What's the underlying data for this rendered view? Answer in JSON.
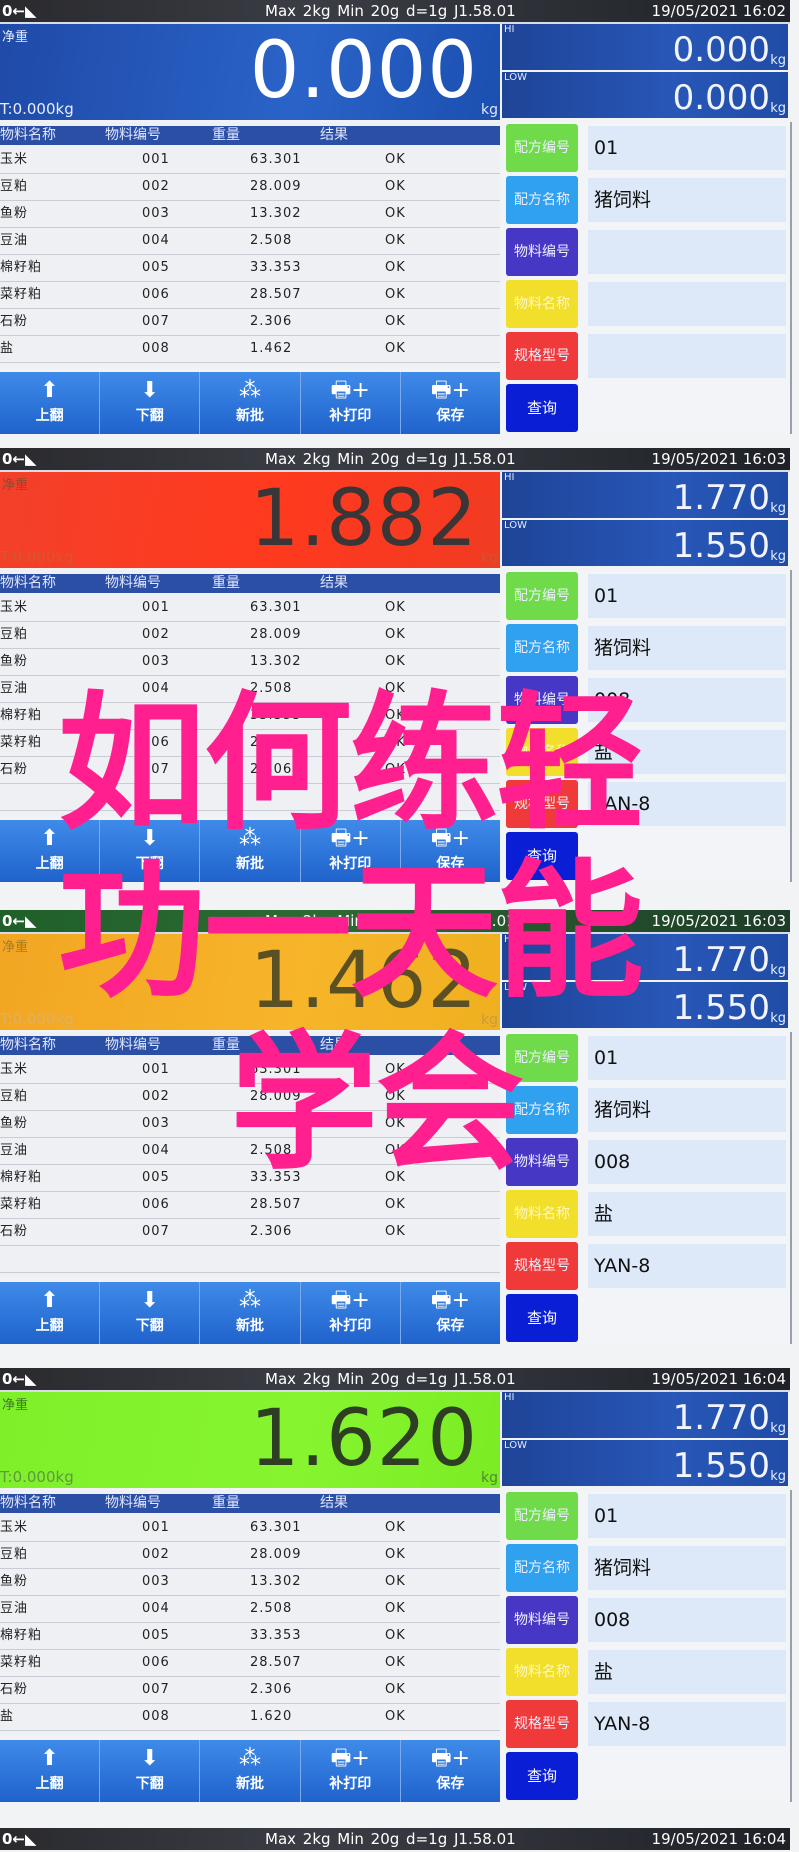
{
  "status_bar": {
    "indicator": "0←◣",
    "scale_spec": "Max 2kg  Min 20g  d=1g   J1.58.01"
  },
  "panels": [
    {
      "datetime": "19/05/2021  16:02",
      "state": "zero",
      "net_label": "净重",
      "net_value": "0.000",
      "unit": "kg",
      "tare": "T:0.000kg",
      "hi_label": "HI",
      "hi_value": "0.000",
      "low_label": "LOW",
      "low_value": "0.000",
      "rows": [
        [
          "玉米",
          "001",
          "63.301",
          "OK"
        ],
        [
          "豆粕",
          "002",
          "28.009",
          "OK"
        ],
        [
          "鱼粉",
          "003",
          "13.302",
          "OK"
        ],
        [
          "豆油",
          "004",
          "2.508",
          "OK"
        ],
        [
          "棉籽粕",
          "005",
          "33.353",
          "OK"
        ],
        [
          "菜籽粕",
          "006",
          "28.507",
          "OK"
        ],
        [
          "石粉",
          "007",
          "2.306",
          "OK"
        ],
        [
          "盐",
          "008",
          "1.462",
          "OK"
        ]
      ],
      "fields": {
        "recipe_no": "01",
        "recipe_name": "猪饲料",
        "material_no": "",
        "material_name": "",
        "spec": ""
      }
    },
    {
      "datetime": "19/05/2021  16:03",
      "state": "over",
      "net_label": "净重",
      "net_value": "1.882",
      "unit": "kg",
      "tare": "T:0.000kg",
      "hi_label": "HI",
      "hi_value": "1.770",
      "low_label": "LOW",
      "low_value": "1.550",
      "rows": [
        [
          "玉米",
          "001",
          "63.301",
          "OK"
        ],
        [
          "豆粕",
          "002",
          "28.009",
          "OK"
        ],
        [
          "鱼粉",
          "003",
          "13.302",
          "OK"
        ],
        [
          "豆油",
          "004",
          "2.508",
          "OK"
        ],
        [
          "棉籽粕",
          "005",
          "33.353",
          "OK"
        ],
        [
          "菜籽粕",
          "006",
          "28.507",
          "OK"
        ],
        [
          "石粉",
          "007",
          "2.306",
          "OK"
        ],
        [
          "",
          "",
          "",
          ""
        ]
      ],
      "fields": {
        "recipe_no": "01",
        "recipe_name": "猪饲料",
        "material_no": "008",
        "material_name": "盐",
        "spec": "YAN-8"
      }
    },
    {
      "datetime": "19/05/2021  16:03",
      "state": "under",
      "net_label": "净重",
      "net_value": "1.462",
      "unit": "kg",
      "tare": "T:0.000kg",
      "hi_label": "HI",
      "hi_value": "1.770",
      "low_label": "LOW",
      "low_value": "1.550",
      "rows": [
        [
          "玉米",
          "001",
          "63.301",
          "OK"
        ],
        [
          "豆粕",
          "002",
          "28.009",
          "OK"
        ],
        [
          "鱼粉",
          "003",
          "13.302",
          "OK"
        ],
        [
          "豆油",
          "004",
          "2.508",
          "OK"
        ],
        [
          "棉籽粕",
          "005",
          "33.353",
          "OK"
        ],
        [
          "菜籽粕",
          "006",
          "28.507",
          "OK"
        ],
        [
          "石粉",
          "007",
          "2.306",
          "OK"
        ],
        [
          "",
          "",
          "",
          ""
        ]
      ],
      "fields": {
        "recipe_no": "01",
        "recipe_name": "猪饲料",
        "material_no": "008",
        "material_name": "盐",
        "spec": "YAN-8"
      }
    },
    {
      "datetime": "19/05/2021  16:04",
      "state": "ok",
      "net_label": "净重",
      "net_value": "1.620",
      "unit": "kg",
      "tare": "T:0.000kg",
      "hi_label": "HI",
      "hi_value": "1.770",
      "low_label": "LOW",
      "low_value": "1.550",
      "rows": [
        [
          "玉米",
          "001",
          "63.301",
          "OK"
        ],
        [
          "豆粕",
          "002",
          "28.009",
          "OK"
        ],
        [
          "鱼粉",
          "003",
          "13.302",
          "OK"
        ],
        [
          "豆油",
          "004",
          "2.508",
          "OK"
        ],
        [
          "棉籽粕",
          "005",
          "33.353",
          "OK"
        ],
        [
          "菜籽粕",
          "006",
          "28.507",
          "OK"
        ],
        [
          "石粉",
          "007",
          "2.306",
          "OK"
        ],
        [
          "盐",
          "008",
          "1.620",
          "OK"
        ]
      ],
      "fields": {
        "recipe_no": "01",
        "recipe_name": "猪饲料",
        "material_no": "008",
        "material_name": "盐",
        "spec": "YAN-8"
      }
    }
  ],
  "final_bar": {
    "datetime": "19/05/2021  16:04"
  },
  "table_headers": [
    "物料名称",
    "物料编号",
    "重量",
    "结果"
  ],
  "field_labels": {
    "recipe_no": "配方编号",
    "recipe_name": "配方名称",
    "material_no": "物料编号",
    "material_name": "物料名称",
    "spec": "规格型号",
    "query": "查询"
  },
  "nav_buttons": [
    {
      "label": "上翻",
      "icon": "arrow-up-icon",
      "glyph": "⬆"
    },
    {
      "label": "下翻",
      "icon": "arrow-down-icon",
      "glyph": "⬇"
    },
    {
      "label": "新批",
      "icon": "new-batch-icon",
      "glyph": "⁂"
    },
    {
      "label": "补打印",
      "icon": "printer-plus-icon",
      "glyph": "🖶+"
    },
    {
      "label": "保存",
      "icon": "save-printer-icon",
      "glyph": "🖶+"
    }
  ],
  "state_colors": {
    "zero": "#2a63c8",
    "over": "#ff3a1e",
    "under": "#f7b52a",
    "ok": "#86f530"
  },
  "overlay_title": [
    "如何练轻",
    "功一天能",
    "学会"
  ],
  "overlay_color": "#ff1f8e"
}
